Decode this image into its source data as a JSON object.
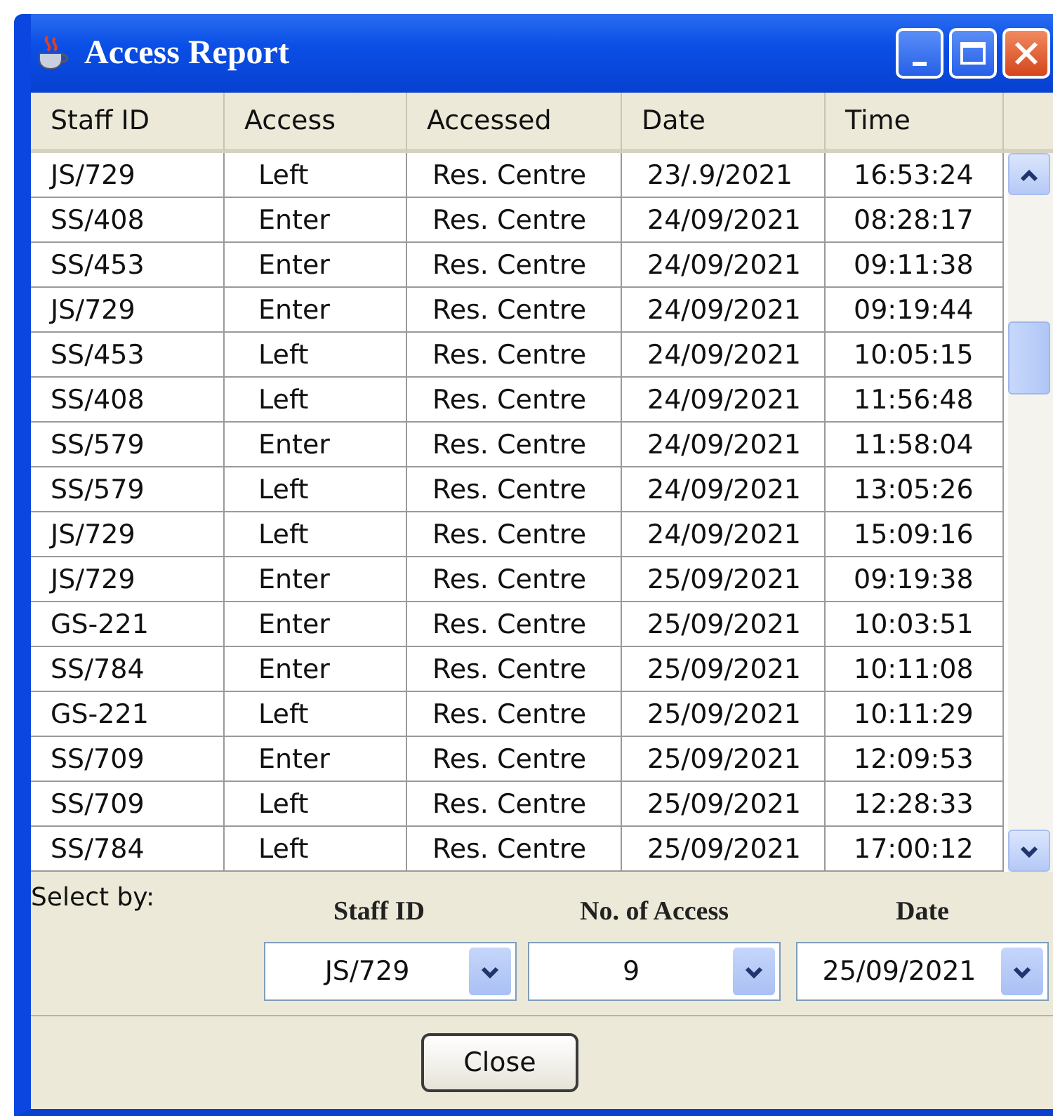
{
  "window": {
    "title": "Access Report"
  },
  "table": {
    "columns": [
      "Staff ID",
      "Access",
      "Accessed",
      "Date",
      "Time"
    ],
    "rows": [
      [
        "JS/729",
        "Left",
        "Res. Centre",
        "23/.9/2021",
        "16:53:24"
      ],
      [
        "SS/408",
        "Enter",
        "Res. Centre",
        "24/09/2021",
        "08:28:17"
      ],
      [
        "SS/453",
        "Enter",
        "Res. Centre",
        "24/09/2021",
        "09:11:38"
      ],
      [
        "JS/729",
        "Enter",
        "Res. Centre",
        "24/09/2021",
        "09:19:44"
      ],
      [
        "SS/453",
        "Left",
        "Res. Centre",
        "24/09/2021",
        "10:05:15"
      ],
      [
        "SS/408",
        "Left",
        "Res. Centre",
        "24/09/2021",
        "11:56:48"
      ],
      [
        "SS/579",
        "Enter",
        "Res. Centre",
        "24/09/2021",
        "11:58:04"
      ],
      [
        "SS/579",
        "Left",
        "Res. Centre",
        "24/09/2021",
        "13:05:26"
      ],
      [
        "JS/729",
        "Left",
        "Res. Centre",
        "24/09/2021",
        "15:09:16"
      ],
      [
        "JS/729",
        "Enter",
        "Res. Centre",
        "25/09/2021",
        "09:19:38"
      ],
      [
        "GS-221",
        "Enter",
        "Res. Centre",
        "25/09/2021",
        "10:03:51"
      ],
      [
        "SS/784",
        "Enter",
        "Res. Centre",
        "25/09/2021",
        "10:11:08"
      ],
      [
        "GS-221",
        "Left",
        "Res. Centre",
        "25/09/2021",
        "10:11:29"
      ],
      [
        "SS/709",
        "Enter",
        "Res. Centre",
        "25/09/2021",
        "12:09:53"
      ],
      [
        "SS/709",
        "Left",
        "Res. Centre",
        "25/09/2021",
        "12:28:33"
      ],
      [
        "SS/784",
        "Left",
        "Res. Centre",
        "25/09/2021",
        "17:00:12"
      ]
    ]
  },
  "filter": {
    "label": "Select by:",
    "fields": [
      {
        "label": "Staff ID",
        "value": "JS/729"
      },
      {
        "label": "No. of Access",
        "value": "9"
      },
      {
        "label": "Date",
        "value": "25/09/2021"
      }
    ]
  },
  "buttons": [
    "Close"
  ]
}
